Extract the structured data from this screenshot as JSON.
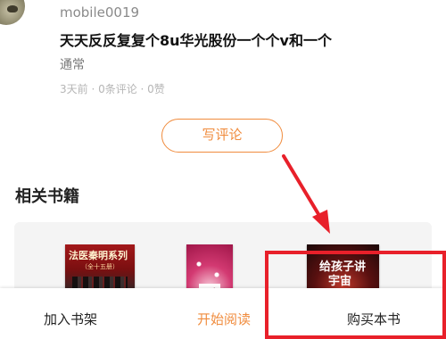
{
  "comment": {
    "username": "mobile0019",
    "text": "天天反反复复个8u华光股份一个个v和一个",
    "tag": "通常",
    "meta": "3天前 · 0条评论 · 0赞"
  },
  "write_review_label": "写评论",
  "related": {
    "title": "相关书籍",
    "books": [
      {
        "cover_title": "法医秦明系列",
        "cover_subtitle": "（全十五册）"
      },
      {
        "cover_char": "后"
      },
      {
        "cover_title_line1": "给孩子讲",
        "cover_title_line2": "宇宙"
      }
    ]
  },
  "bottom_bar": {
    "add_shelf": "加入书架",
    "start_reading": "开始阅读",
    "buy_book": "购买本书"
  },
  "colors": {
    "accent": "#f08c3e",
    "annotation": "#e8202a"
  }
}
